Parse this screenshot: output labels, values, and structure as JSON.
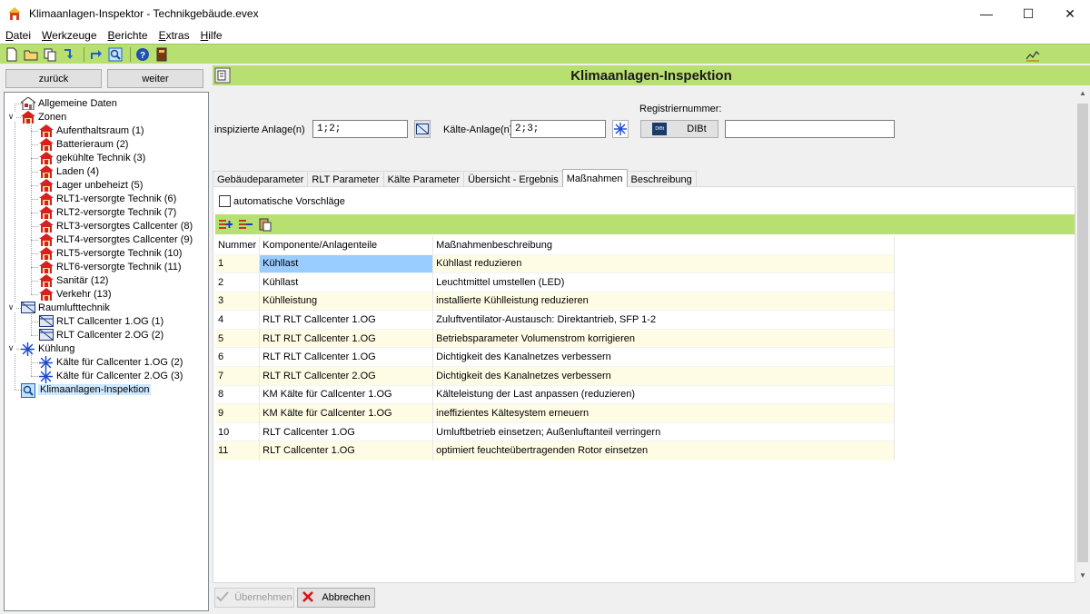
{
  "window": {
    "title": "Klimaanlagen-Inspektor - Technikgebäude.evex"
  },
  "menu": [
    {
      "label": "Datei",
      "accel": "D",
      "rest": "atei"
    },
    {
      "label": "Werkzeuge",
      "accel": "W",
      "rest": "erkzeuge"
    },
    {
      "label": "Berichte",
      "accel": "B",
      "rest": "erichte"
    },
    {
      "label": "Extras",
      "accel": "E",
      "rest": "xtras"
    },
    {
      "label": "Hilfe",
      "accel": "H",
      "rest": "ilfe"
    }
  ],
  "nav": {
    "back": "zurück",
    "forward": "weiter"
  },
  "tree": [
    {
      "label": "Allgemeine Daten",
      "icon": "house-data-icon",
      "level": 0
    },
    {
      "label": "Zonen",
      "icon": "house-red-icon",
      "level": 0,
      "expanded": true
    },
    {
      "label": "Aufenthaltsraum (1)",
      "icon": "house-red-icon",
      "level": 1
    },
    {
      "label": "Batterieraum (2)",
      "icon": "house-red-icon",
      "level": 1
    },
    {
      "label": "gekühlte Technik (3)",
      "icon": "house-red-icon",
      "level": 1
    },
    {
      "label": "Laden (4)",
      "icon": "house-red-icon",
      "level": 1
    },
    {
      "label": "Lager unbeheizt (5)",
      "icon": "house-red-icon",
      "level": 1
    },
    {
      "label": "RLT1-versorgte Technik (6)",
      "icon": "house-red-icon",
      "level": 1
    },
    {
      "label": "RLT2-versorgte Technik (7)",
      "icon": "house-red-icon",
      "level": 1
    },
    {
      "label": "RLT3-versorgtes Callcenter (8)",
      "icon": "house-red-icon",
      "level": 1
    },
    {
      "label": "RLT4-versorgtes Callcenter (9)",
      "icon": "house-red-icon",
      "level": 1
    },
    {
      "label": "RLT5-versorgte Technik (10)",
      "icon": "house-red-icon",
      "level": 1
    },
    {
      "label": "RLT6-versorgte Technik (11)",
      "icon": "house-red-icon",
      "level": 1
    },
    {
      "label": "Sanitär (12)",
      "icon": "house-red-icon",
      "level": 1
    },
    {
      "label": "Verkehr (13)",
      "icon": "house-red-icon",
      "level": 1
    },
    {
      "label": "Raumlufttechnik",
      "icon": "air-unit-icon",
      "level": 0,
      "expanded": true
    },
    {
      "label": "RLT Callcenter 1.OG (1)",
      "icon": "air-unit-icon",
      "level": 1
    },
    {
      "label": "RLT Callcenter 2.OG (2)",
      "icon": "air-unit-icon",
      "level": 1
    },
    {
      "label": "Kühlung",
      "icon": "snowflake-icon",
      "level": 0,
      "expanded": true
    },
    {
      "label": "Kälte für Callcenter 1.OG (2)",
      "icon": "snowflake-icon",
      "level": 1
    },
    {
      "label": "Kälte für Callcenter 2.OG (3)",
      "icon": "snowflake-icon",
      "level": 1
    },
    {
      "label": "Klimaanlagen-Inspektion",
      "icon": "inspection-icon",
      "level": 0,
      "selected": true
    }
  ],
  "header": {
    "title": "Klimaanlagen-Inspektion"
  },
  "form": {
    "registrierungs_label": "Registriernummer:",
    "inspiziert_label": "inspizierte Anlage(n)",
    "inspiziert_value": "1;2;",
    "kaelte_label": "Kälte-Anlage(n)",
    "kaelte_value": "2;3;",
    "dibt_label": "DIBt",
    "dibt_logo": "DIBt",
    "registrierungs_value": ""
  },
  "tabs": [
    "Gebäudeparameter",
    "RLT Parameter",
    "Kälte Parameter",
    "Übersicht - Ergebnis",
    "Maßnahmen",
    "Beschreibung"
  ],
  "active_tab": "Maßnahmen",
  "auto_vorschlaege": {
    "label": "automatische Vorschläge",
    "checked": false
  },
  "table": {
    "headers": [
      "Nummer",
      "Komponente/Anlagenteile",
      "Maßnahmenbeschreibung"
    ],
    "rows": [
      [
        "1",
        "Kühllast",
        "Kühllast reduzieren"
      ],
      [
        "2",
        "Kühllast",
        "Leuchtmittel umstellen (LED)"
      ],
      [
        "3",
        "Kühlleistung",
        "installierte Kühlleistung reduzieren"
      ],
      [
        "4",
        "RLT RLT Callcenter 1.OG",
        "Zuluftventilator-Austausch: Direktantrieb, SFP 1-2"
      ],
      [
        "5",
        "RLT RLT Callcenter 1.OG",
        "Betriebsparameter Volumenstrom korrigieren"
      ],
      [
        "6",
        "RLT RLT Callcenter 1.OG",
        "Dichtigkeit des Kanalnetzes verbessern"
      ],
      [
        "7",
        "RLT RLT Callcenter 2.OG",
        "Dichtigkeit des Kanalnetzes verbessern"
      ],
      [
        "8",
        "KM Kälte für Callcenter 1.OG",
        "Kälteleistung der Last anpassen (reduzieren)"
      ],
      [
        "9",
        "KM Kälte für Callcenter 1.OG",
        "ineffizientes Kältesystem erneuern"
      ],
      [
        "10",
        "RLT Callcenter 1.OG",
        "Umluftbetrieb einsetzen; Außenluftanteil verringern"
      ],
      [
        "11",
        "RLT Callcenter 1.OG",
        "optimiert feuchteübertragenden Rotor einsetzen"
      ]
    ]
  },
  "buttons": {
    "apply": "Übernehmen",
    "cancel": "Abbrechen"
  },
  "colors": {
    "toolbar_green": "#b8e070",
    "selection": "#99ccff",
    "alt_row": "#fffce6"
  }
}
